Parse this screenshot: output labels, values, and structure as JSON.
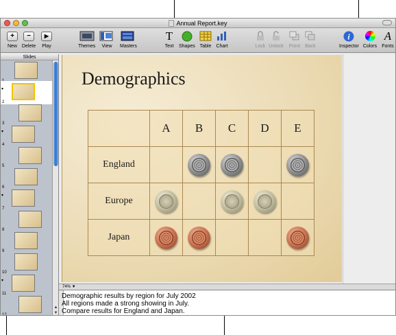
{
  "window": {
    "title": "Annual Report.key",
    "lights": {
      "close": "#ee5a4f",
      "minimize": "#f5b83b",
      "zoom": "#5fc04e"
    }
  },
  "toolbar": {
    "new": "New",
    "delete": "Delete",
    "play": "Play",
    "themes": "Themes",
    "view": "View",
    "masters": "Masters",
    "text": "Text",
    "shapes": "Shapes",
    "table": "Table",
    "chart": "Chart",
    "lock": "Lock",
    "unlock": "Unlock",
    "front": "Front",
    "back": "Back",
    "inspector": "Inspector",
    "colors": "Colors",
    "fonts": "Fonts"
  },
  "navigator": {
    "header": "Slides",
    "slides": [
      {
        "num": "1",
        "disclosure": ""
      },
      {
        "num": "2",
        "disclosure": "▾"
      },
      {
        "num": "3",
        "disclosure": ""
      },
      {
        "num": "4",
        "disclosure": "▾"
      },
      {
        "num": "5",
        "disclosure": ""
      },
      {
        "num": "6",
        "disclosure": ""
      },
      {
        "num": "7",
        "disclosure": "▾"
      },
      {
        "num": "8",
        "disclosure": ""
      },
      {
        "num": "9",
        "disclosure": ""
      },
      {
        "num": "10",
        "disclosure": ""
      },
      {
        "num": "11",
        "disclosure": "▾"
      },
      {
        "num": "12",
        "disclosure": ""
      }
    ],
    "selected": "2"
  },
  "slide": {
    "title": "Demographics",
    "columns": [
      "A",
      "B",
      "C",
      "D",
      "E"
    ],
    "rows": [
      {
        "label": "England",
        "coin": "uk",
        "cells": [
          false,
          true,
          true,
          false,
          true
        ]
      },
      {
        "label": "Europe",
        "coin": "eu",
        "cells": [
          true,
          false,
          true,
          true,
          false
        ]
      },
      {
        "label": "Japan",
        "coin": "jp",
        "cells": [
          true,
          true,
          false,
          false,
          true
        ]
      }
    ]
  },
  "zoom": "74%",
  "notes": [
    "Demographic results by region for July 2002",
    "All regions made a strong showing in July.",
    "Compare results for England and Japan."
  ]
}
